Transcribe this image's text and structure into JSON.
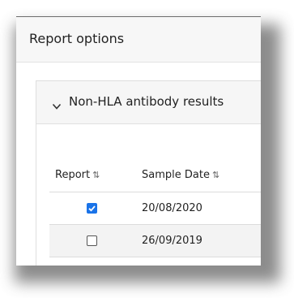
{
  "panel": {
    "title": "Report options"
  },
  "section": {
    "title": "Non-HLA antibody results",
    "expanded": true,
    "chevron_icon": "chevron-down-icon"
  },
  "table": {
    "columns": [
      {
        "label": "Report",
        "sort_icon": "⇅"
      },
      {
        "label": "Sample Date",
        "sort_icon": "⇅"
      }
    ],
    "rows": [
      {
        "report": true,
        "sample_date": "20/08/2020"
      },
      {
        "report": false,
        "sample_date": "26/09/2019"
      }
    ]
  },
  "colors": {
    "checkbox_checked": "#1a73e8",
    "row_alt": "#f3f3f3"
  }
}
